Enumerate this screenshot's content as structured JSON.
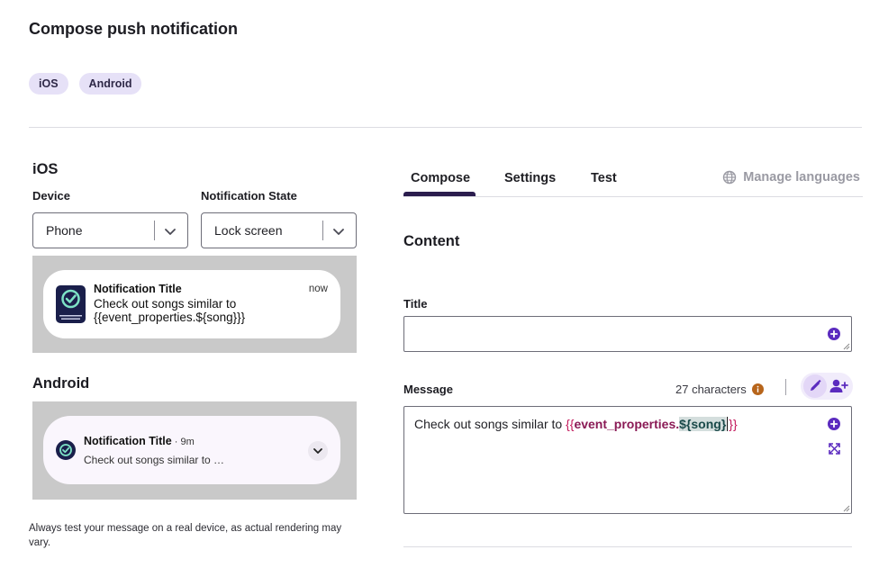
{
  "page": {
    "title": "Compose push notification"
  },
  "platform_chips": [
    "iOS",
    "Android"
  ],
  "ios": {
    "heading": "iOS",
    "device_label": "Device",
    "device_value": "Phone",
    "state_label": "Notification State",
    "state_value": "Lock screen",
    "preview": {
      "title": "Notification Title",
      "time": "now",
      "body": "Check out songs similar to {{event_properties.${song}}}"
    }
  },
  "android": {
    "heading": "Android",
    "preview": {
      "title": "Notification Title",
      "time": " · 9m",
      "body": "Check out songs similar to …"
    }
  },
  "note": "Always test your message on a real device, as actual rendering may vary.",
  "tabs": {
    "compose": "Compose",
    "settings": "Settings",
    "test": "Test",
    "manage_languages": "Manage languages",
    "active": "compose"
  },
  "content": {
    "heading": "Content",
    "title_label": "Title",
    "title_value": "",
    "message_label": "Message",
    "char_count": "27 characters",
    "message": {
      "prefix": "Check out songs similar to ",
      "open_braces": "{{",
      "token_main": "event_properties.",
      "token_song": "${song}",
      "close_braces": "}}"
    }
  },
  "colors": {
    "accent": "#5b2bbf",
    "chip_bg": "#e6e1f7",
    "tab_underline": "#2b1d4e",
    "token_brace": "#c2185b",
    "token_main": "#8a1a55",
    "info_icon": "#b7651b"
  }
}
